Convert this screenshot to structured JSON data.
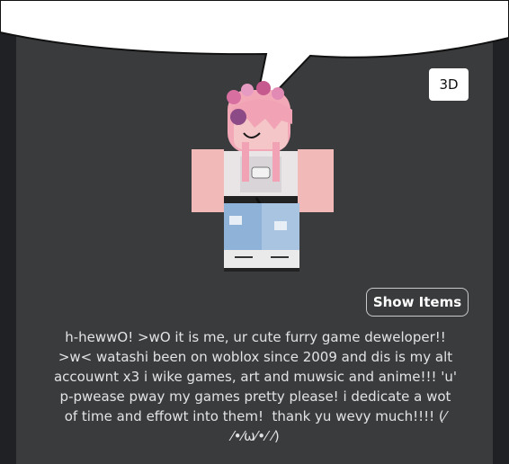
{
  "viewer": {
    "toggle_3d_label": "3D",
    "show_items_label": "Show Items"
  },
  "profile": {
    "about_text": "h-hewwO! >wO it is me, ur cute furry game deweloper!!\n>w< watashi been on woblox since 2009 and dis is my alt\naccouwnt x3 i wike games, art and muwsic and anime!!! 'u'\np-pwease pway my games pretty please! i dedicate a wot\nof time and effowt into them!  thank yu wevy much!!!! (⁄\n⁄•⁄ω⁄•⁄ ⁄)"
  },
  "colors": {
    "panel_background": "#393b3d",
    "side_rail": "#202124",
    "bubble": "#ffffff",
    "button_3d_bg": "#ffffff",
    "text": "#e2e3e5"
  },
  "icons": {
    "avatar": "avatar-figure"
  }
}
